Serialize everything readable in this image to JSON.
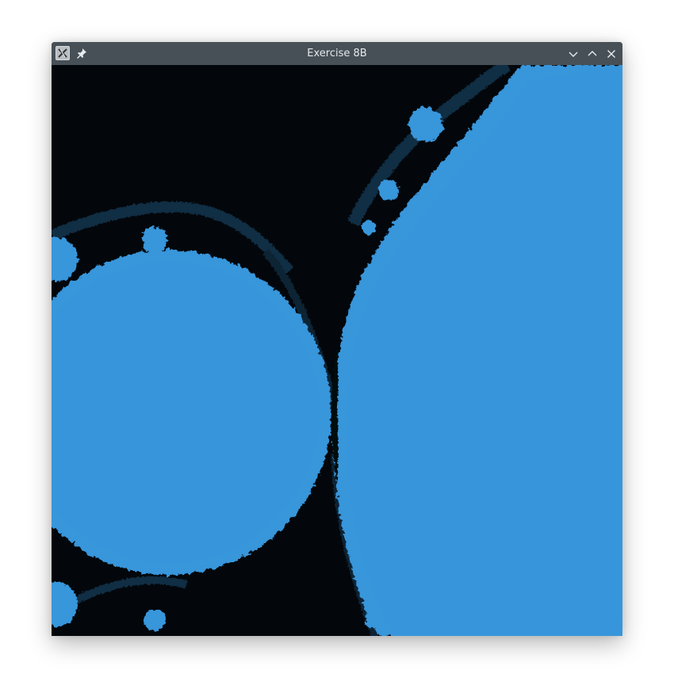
{
  "window": {
    "title": "Exercise 8B",
    "icons": {
      "app": "app-icon",
      "pin": "pin-icon",
      "minimize": "chevron-down-icon",
      "maximize": "chevron-up-icon",
      "close": "close-icon"
    }
  },
  "canvas": {
    "content": "mandelbrot-fractal",
    "colors": {
      "set_fill": "#3796db",
      "background_dark": "#03070b",
      "filament": "#2e6f9c",
      "titlebar": "#475057"
    }
  }
}
